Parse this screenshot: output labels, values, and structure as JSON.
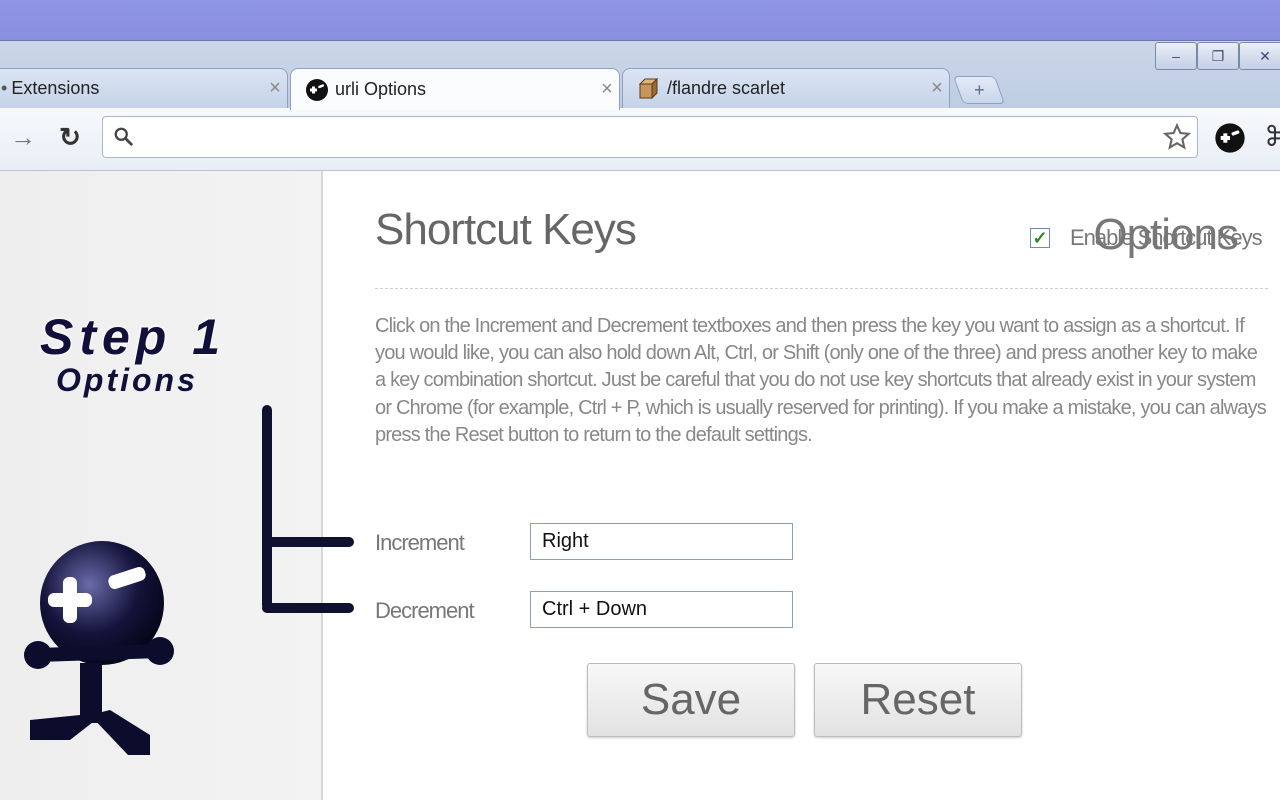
{
  "browser": {
    "tabs": [
      {
        "label": "Extensions",
        "active": false
      },
      {
        "label": "urli Options",
        "active": true
      },
      {
        "label": "/flandre scarlet",
        "active": false
      }
    ],
    "address": {
      "value": ""
    }
  },
  "sidebar": {
    "title": "Options",
    "annotation_title": "Step 1",
    "annotation_subtitle": "Options"
  },
  "main": {
    "title": "Shortcut Keys",
    "enable_label": "Enable Shortcut Keys",
    "enable_checked": true,
    "description": "Click on the Increment and Decrement textboxes and then press the key you want to assign as a shortcut. If you would like, you can also hold down Alt, Ctrl, or Shift (only one of the three) and press another key to make a key combination shortcut. Just be careful that you do not use key shortcuts that already exist in your system or Chrome (for example, Ctrl + P, which is usually reserved for printing). If you make a mistake, you can always press the Reset button to return to the default settings.",
    "fields": [
      {
        "label": "Increment",
        "value": "Right"
      },
      {
        "label": "Decrement",
        "value": "Ctrl + Down"
      }
    ],
    "save_label": "Save",
    "reset_label": "Reset"
  },
  "colors": {
    "accent": "#10103a",
    "desktop": "#8b8fe0",
    "text_gray": "#777777"
  }
}
